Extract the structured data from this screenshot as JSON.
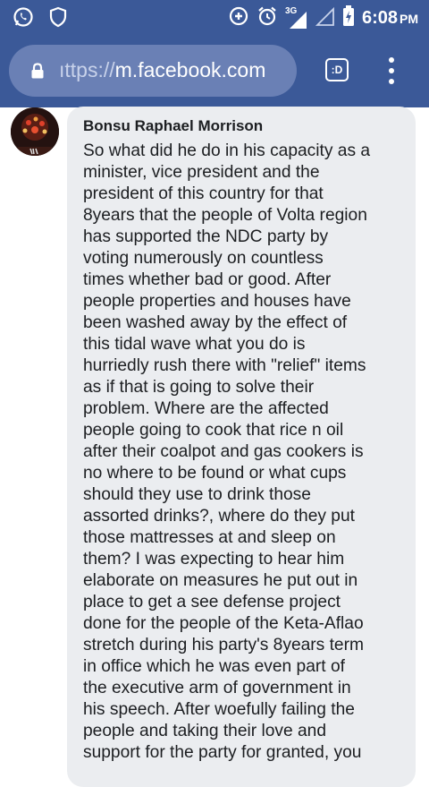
{
  "statusbar": {
    "network": "3G",
    "time": "6:08",
    "ampm": "PM",
    "icons": [
      "whatsapp-icon",
      "shield-icon",
      "data-saver-icon",
      "alarm-icon",
      "signal-icon",
      "signal-empty-icon",
      "battery-charging-icon"
    ]
  },
  "browser": {
    "url_prefix": "ıttps://",
    "url_host": "m.facebook.com",
    "tab_label": ":D",
    "icons": [
      "lock-icon",
      "tab-switcher-icon",
      "more-menu-icon"
    ]
  },
  "comment": {
    "author": "Bonsu Raphael Morrison",
    "lines": [
      "So what did he do in his capacity as a",
      "minister, vice president and the",
      "president of this country for that",
      "8years that the people of Volta region",
      "has supported the NDC party by",
      "voting numerously on countless",
      "times whether bad or good. After",
      "people properties and houses have",
      "been washed away by the effect of",
      "this tidal wave what you do is",
      "hurriedly rush there with \"relief\" items",
      "as if that is going to solve their",
      "problem. Where are the affected",
      "people going to cook that rice n oil",
      "after their coalpot and gas cookers is",
      "no where to be found or what cups",
      "should they use to drink those",
      "assorted drinks?, where do they put",
      "those mattresses at and sleep on",
      "them? I was expecting to hear him",
      "elaborate on measures he put out in",
      "place to get a see defense project",
      "done for the people of the Keta-Aflao",
      "stretch during his party's 8years term",
      "in office which he was even part of",
      "the executive arm of government in",
      "his speech. After woefully failing the",
      "people and taking their love and",
      "support for the party for granted, you"
    ]
  },
  "colors": {
    "brand": "#3b5998",
    "url_pill": "#6a80b5",
    "bubble": "#ebedf0",
    "text": "#1c1e21"
  }
}
